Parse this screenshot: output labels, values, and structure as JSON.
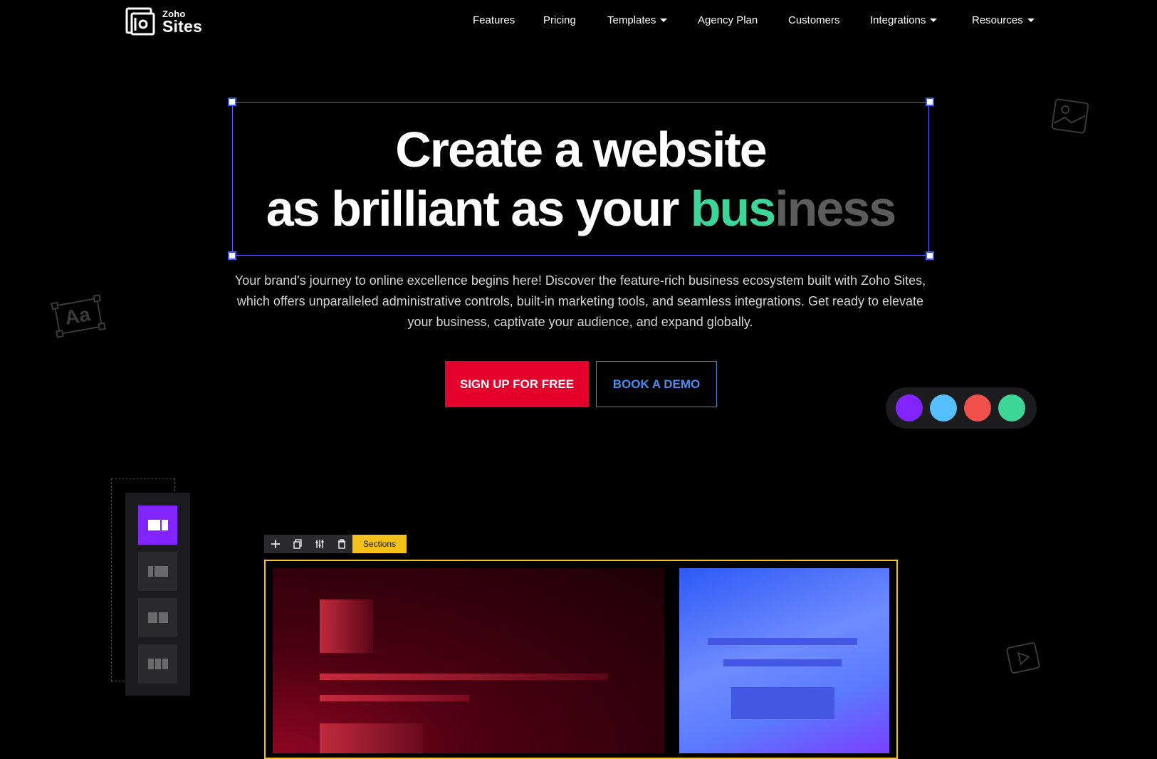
{
  "logo": {
    "top": "Zoho",
    "bottom": "Sites"
  },
  "nav": {
    "items": [
      {
        "label": "Features"
      },
      {
        "label": "Pricing"
      },
      {
        "label": "Templates",
        "dropdown": true
      },
      {
        "label": "Agency Plan"
      },
      {
        "label": "Customers"
      },
      {
        "label": "Integrations",
        "dropdown": true
      },
      {
        "label": "Resources",
        "dropdown": true
      }
    ]
  },
  "hero": {
    "line1": "Create a website",
    "line2_prefix": "as brilliant as your ",
    "line2_typed": "bus",
    "line2_ghost": "iness",
    "subtitle": "Your brand's journey to online excellence begins here! Discover the feature-rich business ecosystem built with Zoho Sites, which offers unparalleled administrative controls, built-in marketing tools, and seamless integrations. Get ready to elevate your business, captivate your audience, and expand globally."
  },
  "cta": {
    "signup": "SIGN UP FOR FREE",
    "demo": "BOOK A DEMO"
  },
  "decorations": {
    "font_sample": "Aa"
  },
  "palette": {
    "colors": [
      "#8124ff",
      "#55c0ff",
      "#f2514b",
      "#3ed598"
    ]
  },
  "toolbar": {
    "sections_label": "Sections"
  },
  "colors": {
    "accent_typed": "#3ed598",
    "signup_bg": "#e4002b",
    "demo_border": "#3f7fe0",
    "section_highlight": "#f5c11b"
  }
}
